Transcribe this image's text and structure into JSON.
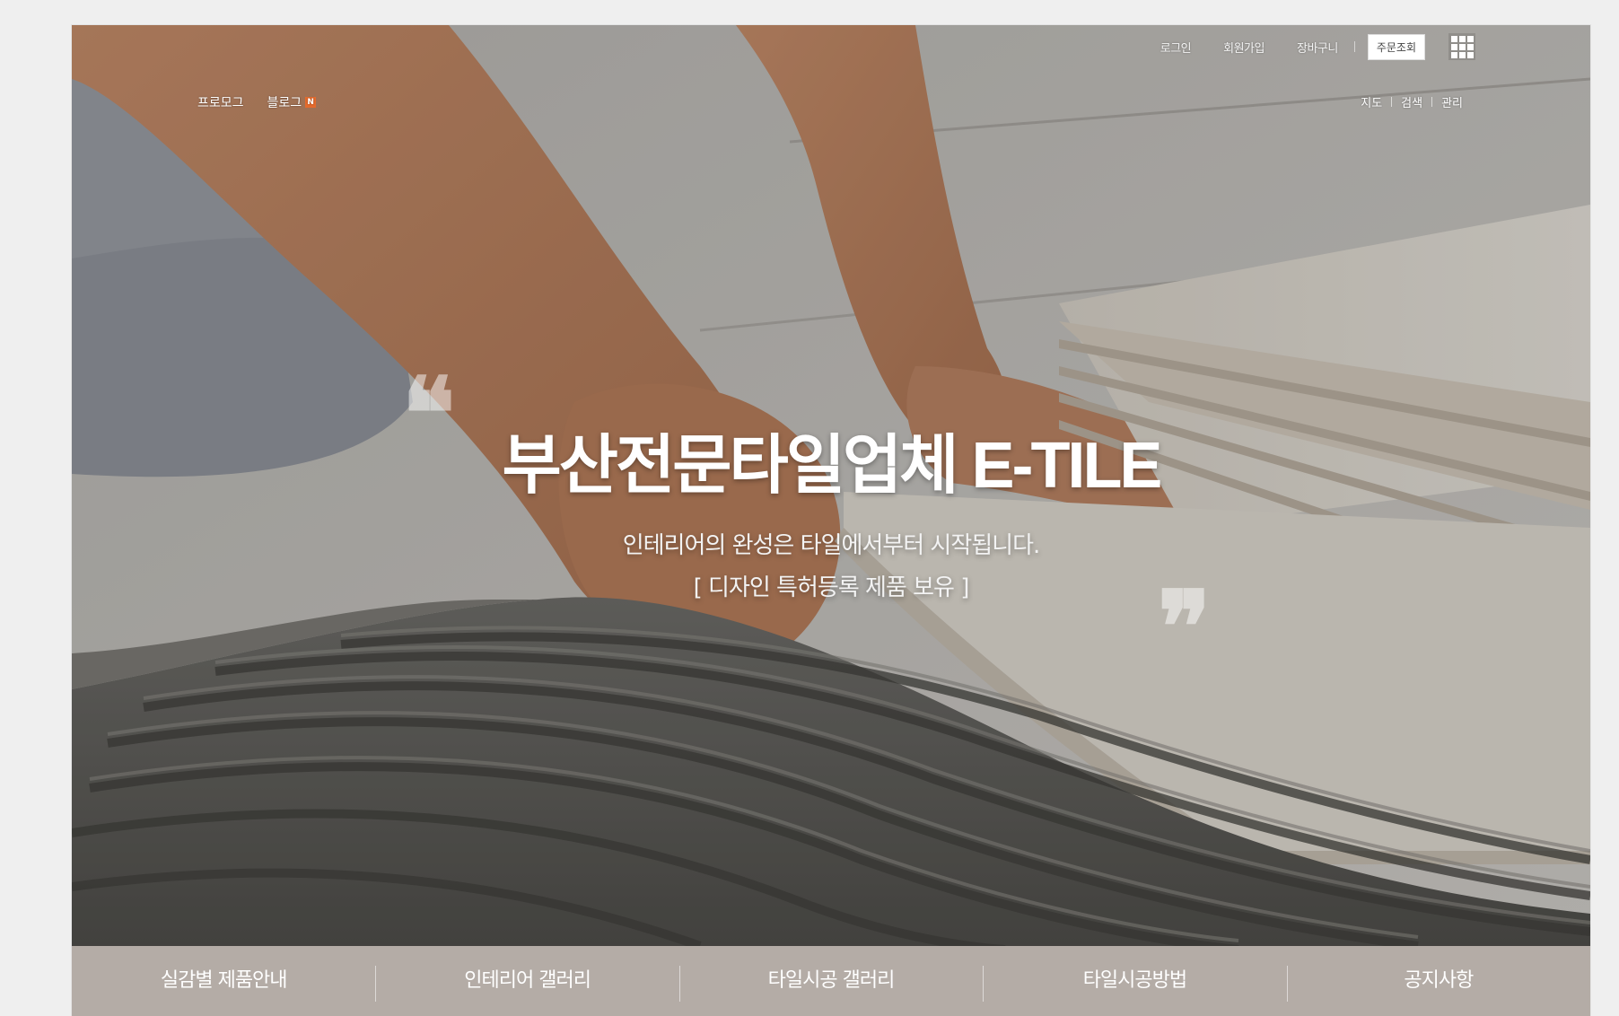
{
  "header": {
    "utility_links": [
      "로그인",
      "회원가입",
      "장바구니"
    ],
    "utility_button": "주문조회",
    "grid_menu_icon": "grid-menu-icon",
    "left_links": [
      {
        "label": "프로모그",
        "badge": ""
      },
      {
        "label": "블로그",
        "badge": "N"
      }
    ],
    "right_links": [
      "지도",
      "검색",
      "관리"
    ]
  },
  "hero": {
    "title": "부산전문타일업체 E-TILE",
    "subtitle": "인테리어의 완성은 타일에서부터 시작됩니다.",
    "subtitle2": "[ 디자인 특허등록 제품 보유 ]",
    "open_quote": "❝",
    "close_quote": "❞"
  },
  "nav": {
    "items": [
      "실감별 제품안내",
      "인테리어 갤러리",
      "타일시공 갤러리",
      "타일시공방법",
      "공지사항"
    ]
  },
  "colors": {
    "nav_bg": "#b4aca6",
    "badge": "#e46a2c"
  }
}
